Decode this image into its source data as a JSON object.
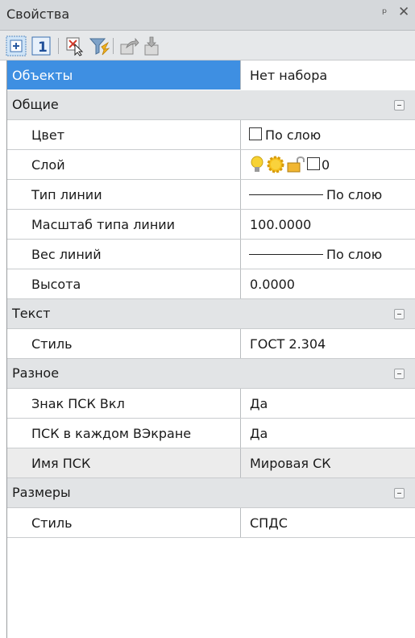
{
  "panel": {
    "title": "Свойства",
    "pin_glyph": "ᵖ",
    "close_glyph": "✕"
  },
  "toolbar": {
    "icons": [
      "quick-select-icon",
      "one-object-icon",
      "select-objects-icon",
      "filter-icon",
      "export-icon",
      "import-icon"
    ]
  },
  "header": {
    "name": "Объекты",
    "value": "Нет набора",
    "accent": "#3e8fe2"
  },
  "categories": [
    {
      "label": "Общие",
      "props": [
        {
          "name": "Цвет",
          "value": "По слою"
        },
        {
          "name": "Слой",
          "value": "0"
        },
        {
          "name": "Тип линии",
          "value": "По слою"
        },
        {
          "name": "Масштаб типа линии",
          "value": "100.0000"
        },
        {
          "name": "Вес линий",
          "value": "По слою"
        },
        {
          "name": "Высота",
          "value": "0.0000"
        }
      ]
    },
    {
      "label": "Текст",
      "props": [
        {
          "name": "Стиль",
          "value": "ГОСТ 2.304"
        }
      ]
    },
    {
      "label": "Разное",
      "props": [
        {
          "name": "Знак ПСК Вкл",
          "value": "Да"
        },
        {
          "name": "ПСК в каждом ВЭкране",
          "value": "Да"
        },
        {
          "name": "Имя ПСК",
          "value": "Мировая СК"
        }
      ]
    },
    {
      "label": "Размеры",
      "props": [
        {
          "name": "Стиль",
          "value": "СПДС"
        }
      ]
    }
  ]
}
